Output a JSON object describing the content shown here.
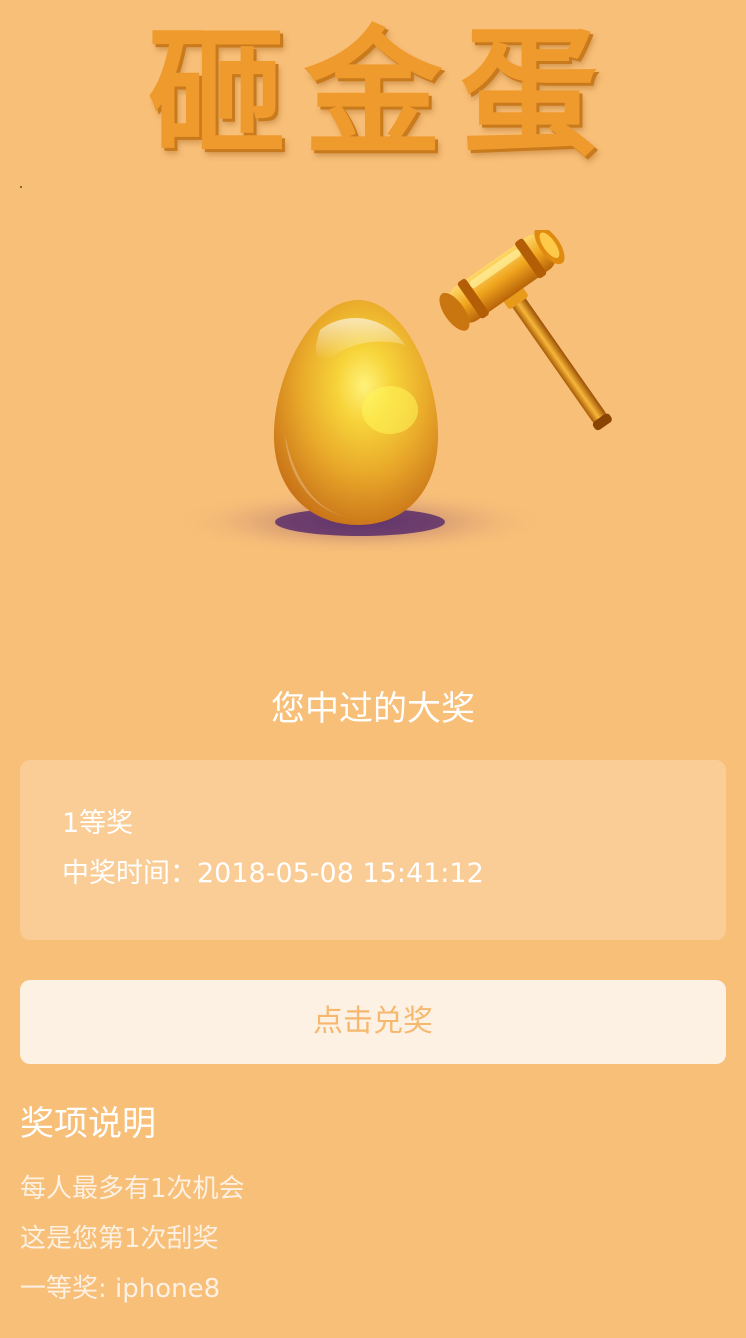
{
  "header": {
    "title": "砸金蛋"
  },
  "scene": {
    "egg": "golden-egg",
    "hammer": "gavel-hammer-icon"
  },
  "won": {
    "heading": "您中过的大奖",
    "prize_name": "1等奖",
    "prize_time": "中奖时间：2018-05-08 15:41:12"
  },
  "redeem": {
    "label": "点击兑奖"
  },
  "rules": {
    "title": "奖项说明",
    "items": [
      "每人最多有1次机会",
      "这是您第1次刮奖",
      "一等奖: iphone8"
    ]
  },
  "colors": {
    "background": "#f8bf78",
    "title": "#ef9a2c",
    "card": "#facc96",
    "button_bg": "#fdf1e3",
    "button_text": "#f6b86e"
  }
}
